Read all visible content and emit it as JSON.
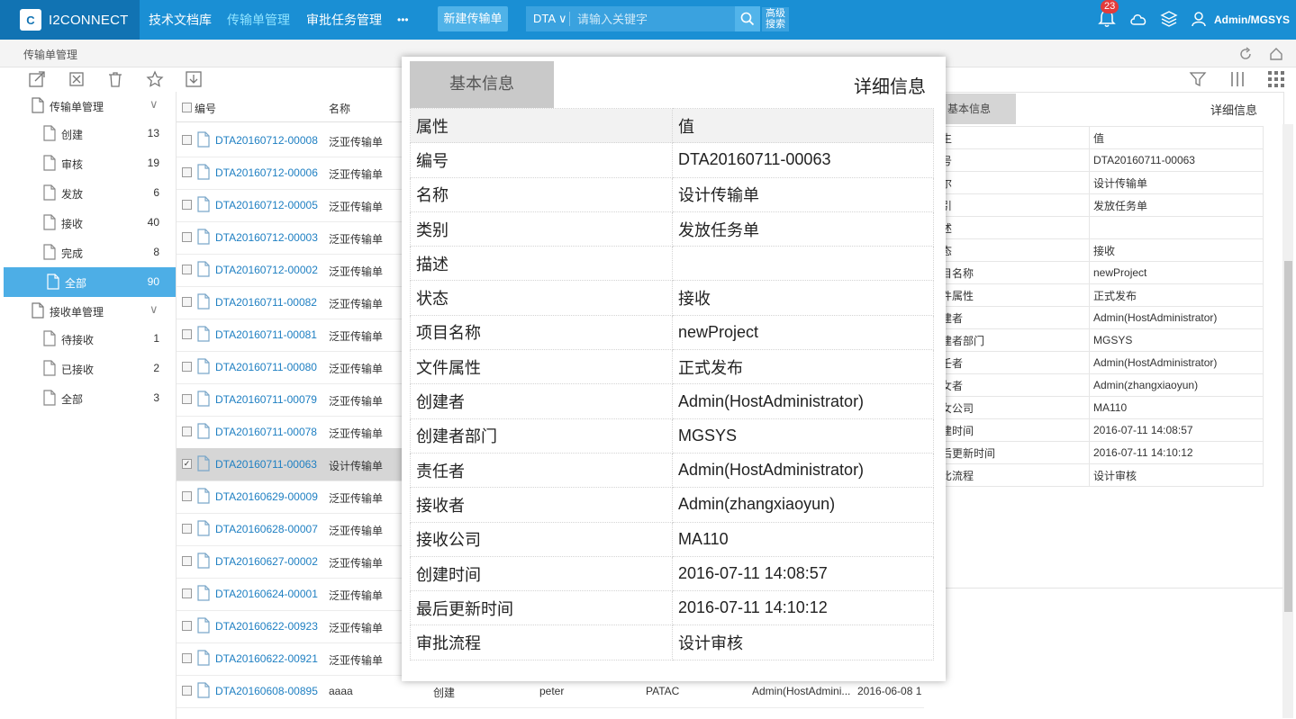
{
  "app": {
    "logo_text": "I2CONNECT"
  },
  "nav": [
    "技术文档库",
    "传输单管理",
    "审批任务管理",
    "•••"
  ],
  "new_button": "新建传输单",
  "search": {
    "prefix": "DTA",
    "placeholder": "请输入关键字",
    "advanced": "高级\n搜索"
  },
  "notifications": {
    "count": "23"
  },
  "user": "Admin/MGSYS",
  "breadcrumb": "传输单管理",
  "sidebar": {
    "groups": [
      {
        "label": "传输单管理",
        "items": [
          {
            "label": "创建",
            "count": "13"
          },
          {
            "label": "审核",
            "count": "19"
          },
          {
            "label": "发放",
            "count": "6"
          },
          {
            "label": "接收",
            "count": "40"
          },
          {
            "label": "完成",
            "count": "8"
          },
          {
            "label": "全部",
            "count": "90"
          }
        ]
      },
      {
        "label": "接收单管理",
        "items": [
          {
            "label": "待接收",
            "count": "1"
          },
          {
            "label": "已接收",
            "count": "2"
          },
          {
            "label": "全部",
            "count": "3"
          }
        ]
      }
    ]
  },
  "list": {
    "headers": [
      "编号",
      "名称"
    ],
    "rows": [
      {
        "code": "DTA20160712-00008",
        "name": "泛亚传输单"
      },
      {
        "code": "DTA20160712-00006",
        "name": "泛亚传输单"
      },
      {
        "code": "DTA20160712-00005",
        "name": "泛亚传输单"
      },
      {
        "code": "DTA20160712-00003",
        "name": "泛亚传输单"
      },
      {
        "code": "DTA20160712-00002",
        "name": "泛亚传输单"
      },
      {
        "code": "DTA20160711-00082",
        "name": "泛亚传输单"
      },
      {
        "code": "DTA20160711-00081",
        "name": "泛亚传输单"
      },
      {
        "code": "DTA20160711-00080",
        "name": "泛亚传输单"
      },
      {
        "code": "DTA20160711-00079",
        "name": "泛亚传输单"
      },
      {
        "code": "DTA20160711-00078",
        "name": "泛亚传输单"
      },
      {
        "code": "DTA20160711-00063",
        "name": "设计传输单",
        "selected": true
      },
      {
        "code": "DTA20160629-00009",
        "name": "泛亚传输单"
      },
      {
        "code": "DTA20160628-00007",
        "name": "泛亚传输单"
      },
      {
        "code": "DTA20160627-00002",
        "name": "泛亚传输单"
      },
      {
        "code": "DTA20160624-00001",
        "name": "泛亚传输单"
      },
      {
        "code": "DTA20160622-00923",
        "name": "泛亚传输单"
      },
      {
        "code": "DTA20160622-00921",
        "name": "泛亚传输单"
      },
      {
        "code": "DTA20160608-00895",
        "name": "aaaa",
        "status": "创建",
        "receiver": "peter",
        "company": "PATAC",
        "creator": "Admin(HostAdmini...",
        "date": "2016-06-08 1"
      }
    ]
  },
  "right_panel": {
    "tab": "基本信息",
    "title": "详细信息",
    "header": [
      "生",
      "值"
    ],
    "rows": [
      [
        "号",
        "DTA20160711-00063"
      ],
      [
        "尔",
        "设计传输单"
      ],
      [
        "引",
        "发放任务单"
      ],
      [
        "述",
        ""
      ],
      [
        "态",
        "接收"
      ],
      [
        "目名称",
        "newProject"
      ],
      [
        "件属性",
        "正式发布"
      ],
      [
        "建者",
        "Admin(HostAdministrator)"
      ],
      [
        "建者部门",
        "MGSYS"
      ],
      [
        "壬者",
        "Admin(HostAdministrator)"
      ],
      [
        "女者",
        "Admin(zhangxiaoyun)"
      ],
      [
        "女公司",
        "MA110"
      ],
      [
        "建时间",
        "2016-07-11 14:08:57"
      ],
      [
        "后更新时间",
        "2016-07-11 14:10:12"
      ],
      [
        "比流程",
        "设计审核"
      ]
    ]
  },
  "popup": {
    "tab": "基本信息",
    "title": "详细信息",
    "header": [
      "属性",
      "值"
    ],
    "rows": [
      [
        "编号",
        "DTA20160711-00063"
      ],
      [
        "名称",
        "设计传输单"
      ],
      [
        "类别",
        "发放任务单"
      ],
      [
        "描述",
        ""
      ],
      [
        "状态",
        "接收"
      ],
      [
        "项目名称",
        "newProject"
      ],
      [
        "文件属性",
        "正式发布"
      ],
      [
        "创建者",
        "Admin(HostAdministrator)"
      ],
      [
        "创建者部门",
        "MGSYS"
      ],
      [
        "责任者",
        "Admin(HostAdministrator)"
      ],
      [
        "接收者",
        "Admin(zhangxiaoyun)"
      ],
      [
        "接收公司",
        "MA110"
      ],
      [
        "创建时间",
        "2016-07-11 14:08:57"
      ],
      [
        "最后更新时间",
        "2016-07-11 14:10:12"
      ],
      [
        "审批流程",
        "设计审核"
      ]
    ]
  }
}
